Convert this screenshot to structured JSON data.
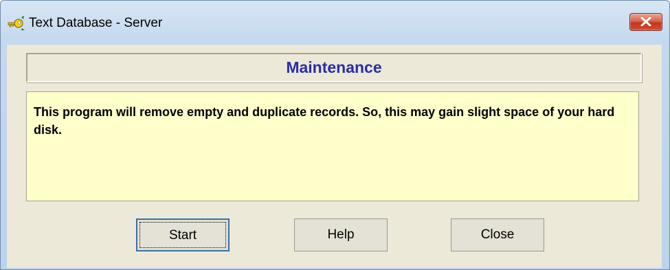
{
  "window": {
    "title": "Text Database - Server",
    "app_icon": "key-icon",
    "close_icon": "close-icon"
  },
  "header": {
    "title": "Maintenance",
    "title_color": "#2a2ea8"
  },
  "message": {
    "text": "This program will remove empty and duplicate records. So, this may gain slight space of your hard disk.",
    "background": "#ffffcc"
  },
  "buttons": {
    "start_label": "Start",
    "help_label": "Help",
    "close_label": "Close"
  },
  "colors": {
    "dialog_face": "#ece9d8",
    "close_button": "#c4361e",
    "focus_border": "#3a6ea5"
  }
}
